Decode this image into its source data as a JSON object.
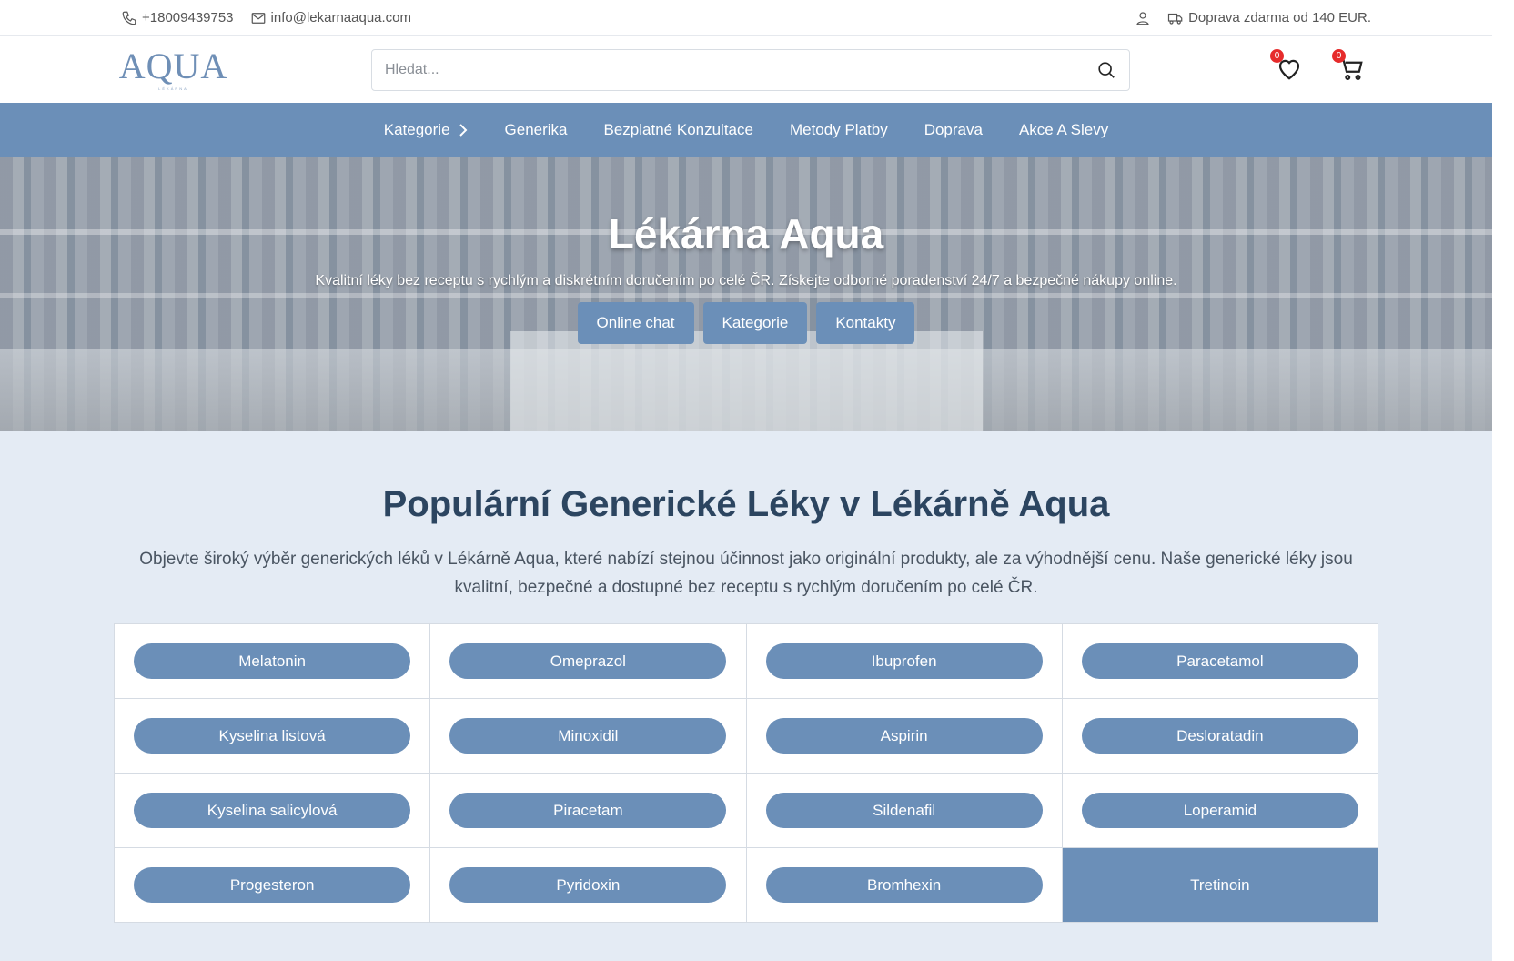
{
  "topbar": {
    "phone": "+18009439753",
    "email": "info@lekarnaaqua.com",
    "shipping": "Doprava zdarma od 140 EUR."
  },
  "header": {
    "logo_text": "AQUA",
    "logo_sub": "LÉKÁRNA",
    "search_placeholder": "Hledat...",
    "wishlist_count": "0",
    "cart_count": "0"
  },
  "nav": {
    "items": [
      "Kategorie",
      "Generika",
      "Bezplatné Konzultace",
      "Metody Platby",
      "Doprava",
      "Akce A Slevy"
    ]
  },
  "hero": {
    "title": "Lékárna Aqua",
    "subtitle": "Kvalitní léky bez receptu s rychlým a diskrétním doručením po celé ČR. Získejte odborné poradenství 24/7 a bezpečné nákupy online.",
    "buttons": [
      "Online chat",
      "Kategorie",
      "Kontakty"
    ]
  },
  "section": {
    "title": "Populární Generické Léky v Lékárně Aqua",
    "intro": "Objevte široký výběr generických léků v Lékárně Aqua, které nabízí stejnou účinnost jako originální produkty, ale za výhodnější cenu. Naše generické léky jsou kvalitní, bezpečné a dostupné bez receptu s rychlým doručením po celé ČR."
  },
  "drugs": [
    "Melatonin",
    "Omeprazol",
    "Ibuprofen",
    "Paracetamol",
    "Kyselina listová",
    "Minoxidil",
    "Aspirin",
    "Desloratadin",
    "Kyselina salicylová",
    "Piracetam",
    "Sildenafil",
    "Loperamid",
    "Progesteron",
    "Pyridoxin",
    "Bromhexin",
    "Tretinoin"
  ],
  "colors": {
    "accent": "#6b8fb8",
    "section_bg": "#e4ebf4",
    "heading": "#2c4560",
    "badge": "#e62b2b"
  },
  "icons": [
    "phone-icon",
    "mail-icon",
    "user-icon",
    "truck-icon",
    "search-icon",
    "heart-icon",
    "cart-icon",
    "chevron-right-icon"
  ]
}
